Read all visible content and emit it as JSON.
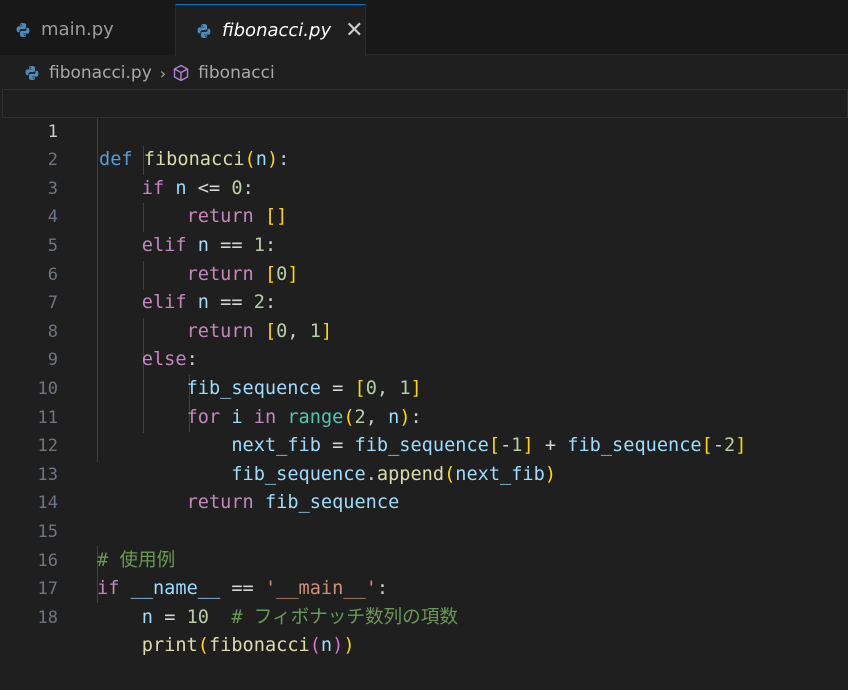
{
  "tabs": [
    {
      "label": "main.py",
      "active": false
    },
    {
      "label": "fibonacci.py",
      "active": true
    }
  ],
  "breadcrumb": {
    "file": "fibonacci.py",
    "symbol": "fibonacci"
  },
  "editor": {
    "active_line": 1,
    "lines": [
      {
        "n": "1",
        "text": "def fibonacci(n):"
      },
      {
        "n": "2",
        "text": "    if n <= 0:"
      },
      {
        "n": "3",
        "text": "        return []"
      },
      {
        "n": "4",
        "text": "    elif n == 1:"
      },
      {
        "n": "5",
        "text": "        return [0]"
      },
      {
        "n": "6",
        "text": "    elif n == 2:"
      },
      {
        "n": "7",
        "text": "        return [0, 1]"
      },
      {
        "n": "8",
        "text": "    else:"
      },
      {
        "n": "9",
        "text": "        fib_sequence = [0, 1]"
      },
      {
        "n": "10",
        "text": "        for i in range(2, n):"
      },
      {
        "n": "11",
        "text": "            next_fib = fib_sequence[-1] + fib_sequence[-2]"
      },
      {
        "n": "12",
        "text": "            fib_sequence.append(next_fib)"
      },
      {
        "n": "13",
        "text": "        return fib_sequence"
      },
      {
        "n": "14",
        "text": ""
      },
      {
        "n": "15",
        "text": "# 使用例"
      },
      {
        "n": "16",
        "text": "if __name__ == '__main__':"
      },
      {
        "n": "17",
        "text": "    n = 10  # フィボナッチ数列の項数"
      },
      {
        "n": "18",
        "text": "    print(fibonacci(n))"
      }
    ]
  },
  "colors": {
    "background": "#1f1f1f",
    "keyword": "#569cd6",
    "control": "#c586c0",
    "function": "#dcdcaa",
    "variable": "#9cdcfe",
    "number": "#b5cea8",
    "string": "#ce9178",
    "comment": "#6a9955",
    "bracket_1": "#ffd700",
    "bracket_2": "#da70d6",
    "bracket_3": "#179fff",
    "tab_accent": "#0078d4"
  },
  "icons": {
    "python_file": "python-icon",
    "symbol": "symbol-method-icon",
    "close": "close-icon",
    "chevron": "chevron-right-icon"
  }
}
